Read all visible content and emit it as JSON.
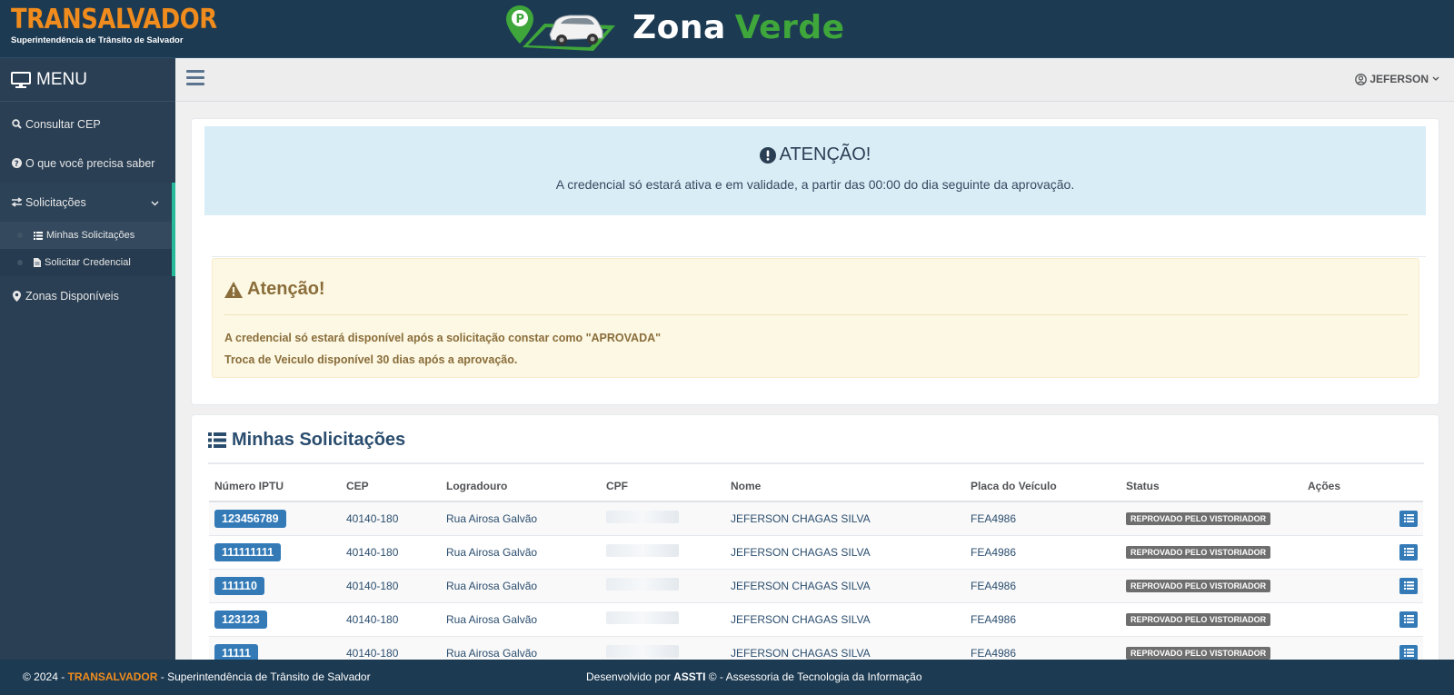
{
  "header": {
    "brand_name": "TRANSALVADOR",
    "brand_subtitle": "Superintendência de Trânsito de Salvador",
    "title_word1": "Zona",
    "title_word2": "Verde"
  },
  "sidebar": {
    "menu_label": "MENU",
    "items": [
      {
        "label": "Consultar CEP",
        "icon": "search-icon"
      },
      {
        "label": "O que você precisa saber",
        "icon": "question-icon"
      },
      {
        "label": "Solicitações",
        "icon": "exchange-icon",
        "expanded": true
      },
      {
        "label": "Zonas Disponíveis",
        "icon": "map-marker-icon"
      }
    ],
    "subitems": [
      {
        "label": "Minhas Solicitações",
        "icon": "list-icon",
        "active": true
      },
      {
        "label": "Solicitar Credencial",
        "icon": "file-icon"
      }
    ]
  },
  "topnav": {
    "user_name": "JEFERSON"
  },
  "info_alert": {
    "title": "ATENÇÃO!",
    "text": "A credencial só estará ativa e em validade, a partir das 00:00 do dia seguinte da aprovação."
  },
  "warning_alert": {
    "title": "Atenção!",
    "line1": "A credencial só estará disponível após a solicitação constar como \"APROVADA\"",
    "line2": "Troca de Veiculo disponível 30 dias após a aprovação."
  },
  "requests": {
    "title": "Minhas Solicitações",
    "columns": [
      "Número IPTU",
      "CEP",
      "Logradouro",
      "CPF",
      "Nome",
      "Placa do Veículo",
      "Status",
      "Ações"
    ],
    "rows": [
      {
        "iptu": "123456789",
        "cep": "40140-180",
        "logradouro": "Rua Airosa Galvão",
        "nome": "JEFERSON CHAGAS SILVA",
        "placa": "FEA4986",
        "status": "REPROVADO PELO VISTORIADOR"
      },
      {
        "iptu": "111111111",
        "cep": "40140-180",
        "logradouro": "Rua Airosa Galvão",
        "nome": "JEFERSON CHAGAS SILVA",
        "placa": "FEA4986",
        "status": "REPROVADO PELO VISTORIADOR"
      },
      {
        "iptu": "111110",
        "cep": "40140-180",
        "logradouro": "Rua Airosa Galvão",
        "nome": "JEFERSON CHAGAS SILVA",
        "placa": "FEA4986",
        "status": "REPROVADO PELO VISTORIADOR"
      },
      {
        "iptu": "123123",
        "cep": "40140-180",
        "logradouro": "Rua Airosa Galvão",
        "nome": "JEFERSON CHAGAS SILVA",
        "placa": "FEA4986",
        "status": "REPROVADO PELO VISTORIADOR"
      },
      {
        "iptu": "11111",
        "cep": "40140-180",
        "logradouro": "Rua Airosa Galvão",
        "nome": "JEFERSON CHAGAS SILVA",
        "placa": "FEA4986",
        "status": "REPROVADO PELO VISTORIADOR"
      }
    ]
  },
  "footer": {
    "copy_prefix": "© 2024 - ",
    "org": "TRANSALVADOR",
    "copy_suffix": " - Superintendência de Trânsito de Salvador",
    "dev_prefix": "Desenvolvido por ",
    "dev_name": "ASSTI",
    "dev_suffix": " © - Assessoria de Tecnologia da Informação"
  },
  "colors": {
    "header_bg": "#1c3a52",
    "sidebar_bg": "#2a3f54",
    "brand_orange": "#f08c1d",
    "accent_green": "#26b99a",
    "button_blue": "#337ab7",
    "status_gray": "#6e6e6e"
  }
}
